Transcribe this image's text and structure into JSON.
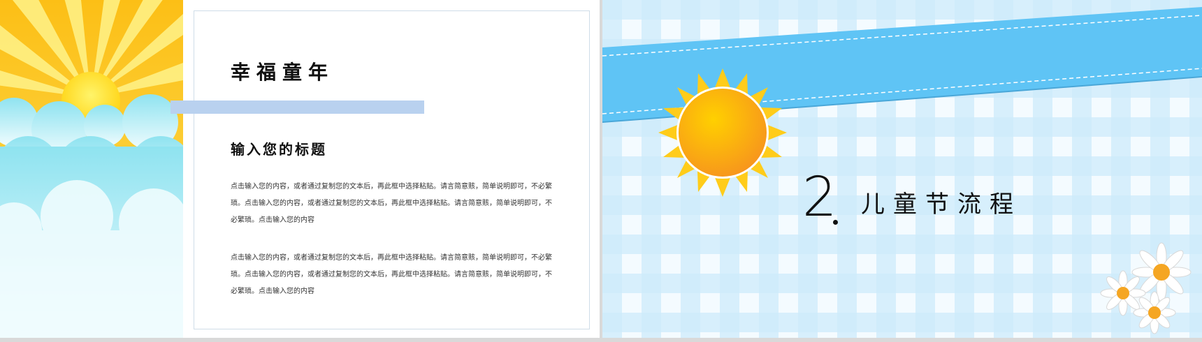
{
  "left_slide": {
    "title": "幸福童年",
    "subtitle": "输入您的标题",
    "paragraphs": [
      "点击输入您的内容，或者通过复制您的文本后，再此框中选择粘贴。请言简意赅，简单说明即可，不必繁琐。点击输入您的内容，或者通过复制您的文本后，再此框中选择粘贴。请言简意赅，简单说明即可，不必繁琐。点击输入您的内容",
      "点击输入您的内容，或者通过复制您的文本后，再此框中选择粘贴。请言简意赅，简单说明即可，不必繁琐。点击输入您的内容，或者通过复制您的文本后，再此框中选择粘贴。请言简意赅，简单说明即可，不必繁琐。点击输入您的内容"
    ]
  },
  "right_slide": {
    "section_number": "2",
    "section_title": "儿童节流程"
  },
  "colors": {
    "sun_yellow": "#ffd21f",
    "sun_orange": "#f7a21b",
    "sky_cyan": "#8fe3f0",
    "ribbon_blue": "#5fc4f5",
    "gingham_light": "#e8f5fd",
    "gingham_mid": "#c9e8fa",
    "accent_bar": "#b9d1ef"
  },
  "icons": [
    "sun-icon",
    "cloud-icon",
    "daisy-icon"
  ]
}
